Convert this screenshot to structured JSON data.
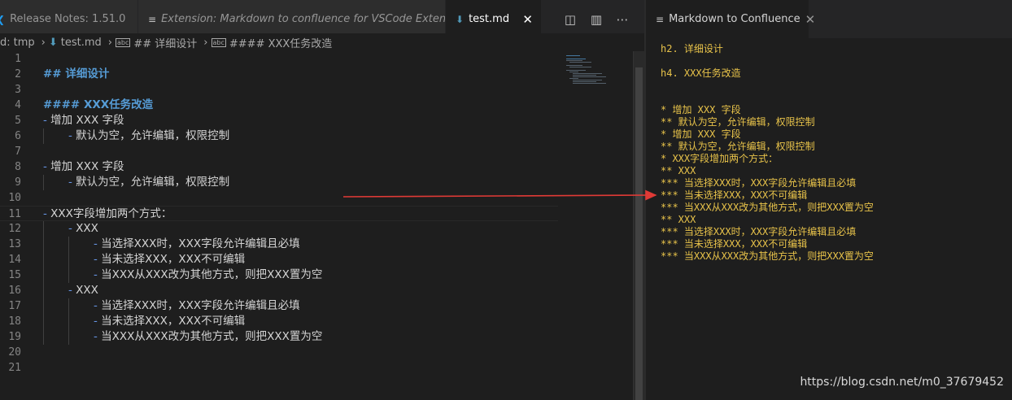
{
  "tabs": [
    {
      "label": "Release Notes: 1.51.0",
      "icon": "vscode-logo-icon"
    },
    {
      "label": "Extension: Markdown to confluence for VSCode Extension",
      "icon": "preview-icon"
    },
    {
      "label": "test.md",
      "icon": "markdown-file-icon",
      "close": "✕"
    }
  ],
  "tab_actions": {
    "split_preview": "◫",
    "split_editor": "▥",
    "more": "⋯"
  },
  "breadcrumb": {
    "drive": "d:",
    "folder": "tmp",
    "file": "test.md",
    "section1": "## 详细设计",
    "section2": "#### XXX任务改造"
  },
  "editor": {
    "lines": [
      {
        "n": "1",
        "text": "",
        "indent": 0,
        "kind": "text"
      },
      {
        "n": "2",
        "text": "## 详细设计",
        "indent": 0,
        "kind": "heading"
      },
      {
        "n": "3",
        "text": "",
        "indent": 0,
        "kind": "text"
      },
      {
        "n": "4",
        "text": "#### XXX任务改造",
        "indent": 0,
        "kind": "heading"
      },
      {
        "n": "5",
        "bullet": "-",
        "text": "增加 XXX 字段",
        "indent": 0,
        "kind": "bullet"
      },
      {
        "n": "6",
        "bullet": "-",
        "text": "默认为空，允许编辑，权限控制",
        "indent": 1,
        "kind": "bullet"
      },
      {
        "n": "7",
        "text": "",
        "indent": 0,
        "kind": "text"
      },
      {
        "n": "8",
        "bullet": "-",
        "text": "增加 XXX 字段",
        "indent": 0,
        "kind": "bullet"
      },
      {
        "n": "9",
        "bullet": "-",
        "text": "默认为空，允许编辑，权限控制",
        "indent": 1,
        "kind": "bullet"
      },
      {
        "n": "10",
        "text": "",
        "indent": 0,
        "kind": "text"
      },
      {
        "n": "11",
        "bullet": "-",
        "text": "XXX字段增加两个方式：",
        "indent": 0,
        "kind": "bullet",
        "current": true
      },
      {
        "n": "12",
        "bullet": "-",
        "text": "XXX",
        "indent": 1,
        "kind": "bullet"
      },
      {
        "n": "13",
        "bullet": "-",
        "text": "当选择XXX时，XXX字段允许编辑且必填",
        "indent": 2,
        "kind": "bullet"
      },
      {
        "n": "14",
        "bullet": "-",
        "text": "当未选择XXX，XXX不可编辑",
        "indent": 2,
        "kind": "bullet"
      },
      {
        "n": "15",
        "bullet": "-",
        "text": "当XXX从XXX改为其他方式，则把XXX置为空",
        "indent": 2,
        "kind": "bullet"
      },
      {
        "n": "16",
        "bullet": "-",
        "text": "XXX",
        "indent": 1,
        "kind": "bullet"
      },
      {
        "n": "17",
        "bullet": "-",
        "text": "当选择XXX时，XXX字段允许编辑且必填",
        "indent": 2,
        "kind": "bullet"
      },
      {
        "n": "18",
        "bullet": "-",
        "text": "当未选择XXX，XXX不可编辑",
        "indent": 2,
        "kind": "bullet"
      },
      {
        "n": "19",
        "bullet": "-",
        "text": "当XXX从XXX改为其他方式，则把XXX置为空",
        "indent": 2,
        "kind": "bullet"
      },
      {
        "n": "20",
        "text": "",
        "indent": 0,
        "kind": "text"
      },
      {
        "n": "21",
        "text": "",
        "indent": 0,
        "kind": "text"
      }
    ]
  },
  "preview": {
    "tab_label": "Markdown to Confluence",
    "tab_icon": "preview-icon",
    "close": "✕",
    "lines": [
      "h2. 详细设计",
      "",
      "h4. XXX任务改造",
      "",
      "",
      "* 增加 XXX 字段",
      "** 默认为空，允许编辑，权限控制",
      "* 增加 XXX 字段",
      "** 默认为空，允许编辑，权限控制",
      "* XXX字段增加两个方式：",
      "** XXX",
      "*** 当选择XXX时，XXX字段允许编辑且必填",
      "*** 当未选择XXX，XXX不可编辑",
      "*** 当XXX从XXX改为其他方式，则把XXX置为空",
      "** XXX",
      "*** 当选择XXX时，XXX字段允许编辑且必填",
      "*** 当未选择XXX，XXX不可编辑",
      "*** 当XXX从XXX改为其他方式，则把XXX置为空"
    ]
  },
  "watermark": "https://blog.csdn.net/m0_37679452",
  "colors": {
    "heading": "#569cd6",
    "bullet": "#6796e6",
    "preview_text": "#e8c34a",
    "arrow": "#e03a36"
  }
}
